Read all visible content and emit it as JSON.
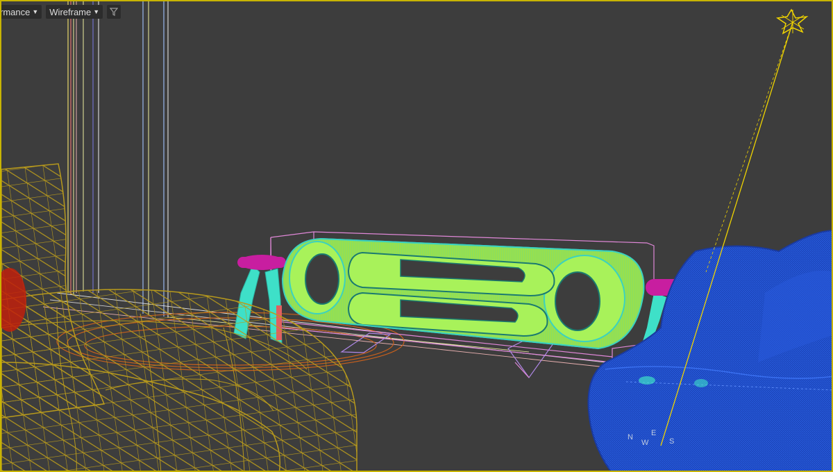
{
  "toolbar": {
    "shading_mode": "rmance",
    "render_mode": "Wireframe",
    "filter_icon": "funnel-icon"
  },
  "compass": {
    "north": "N",
    "east": "E",
    "west": "W",
    "south": "S"
  },
  "colors": {
    "viewport_border": "#c8b400",
    "background": "#3d3d3d",
    "chair_wireframe": "#b89a1c",
    "sofa_wireframe": "#1f4fd0",
    "cabinet_green": "#a8f25a",
    "cabinet_cyan": "#3ad2c0",
    "stool_magenta": "#c81ea0",
    "light_gizmo": "#f0d400"
  }
}
